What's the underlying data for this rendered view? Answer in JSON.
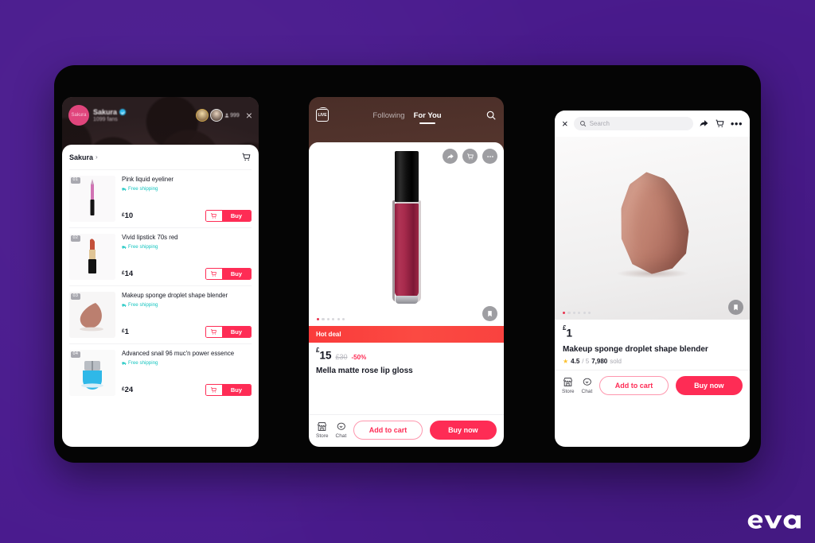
{
  "background": {
    "color": "#4a1b8e",
    "frame_color": "#050505"
  },
  "brand": {
    "logo_text": "eva"
  },
  "phone_left": {
    "name": "live-shopping-stream",
    "stream": {
      "streamer_name": "Sakura",
      "fans": "1099 fans",
      "avatar_label": "Sakura",
      "viewer_count": "999",
      "close_label": "×",
      "verified": true
    },
    "sheet": {
      "shop_name": "Sakura",
      "chevron": "›",
      "cart_icon": "cart-icon",
      "products": [
        {
          "rank": "01",
          "title": "Pink liquid eyeliner",
          "shipping": "Free shipping",
          "price_symbol": "£",
          "price": "10",
          "buy_label": "Buy"
        },
        {
          "rank": "02",
          "title": "Vivid lipstick 70s red",
          "shipping": "Free shipping",
          "price_symbol": "£",
          "price": "14",
          "buy_label": "Buy"
        },
        {
          "rank": "03",
          "title": "Makeup sponge droplet shape blender",
          "shipping": "Free shipping",
          "price_symbol": "£",
          "price": "1",
          "buy_label": "Buy"
        },
        {
          "rank": "04",
          "title": "Advanced snail 96 muc'n power essence",
          "shipping": "Free shipping",
          "price_symbol": "£",
          "price": "24",
          "buy_label": "Buy"
        }
      ]
    }
  },
  "phone_middle": {
    "name": "video-feed-product-card",
    "feed": {
      "live_label": "LIVE",
      "tab_following": "Following",
      "tab_foryou": "For You",
      "search_icon": "search-icon"
    },
    "card": {
      "share_icon": "share-icon",
      "cart_icon": "cart-icon",
      "more_icon": "more-icon",
      "bookmark_icon": "bookmark-icon",
      "carousel_dots": 6,
      "active_dot": 1,
      "banner": "Hot deal",
      "price_symbol": "£",
      "price": "15",
      "old_price": "£30",
      "discount": "-50%",
      "title": "Mella matte rose lip gloss",
      "store_label": "Store",
      "chat_label": "Chat",
      "add_to_cart": "Add to cart",
      "buy_now": "Buy now"
    }
  },
  "phone_right": {
    "name": "product-detail-page",
    "topbar": {
      "close_label": "×",
      "search_placeholder": "Search",
      "search_icon": "search-icon",
      "share_icon": "share-icon",
      "cart_icon": "cart-icon",
      "more_icon": "more-icon"
    },
    "gallery": {
      "carousel_dots": 6,
      "active_dot": 1,
      "bookmark_icon": "bookmark-icon"
    },
    "product": {
      "price_symbol": "£",
      "price": "1",
      "title": "Makeup sponge droplet shape blender",
      "star_icon": "star-icon",
      "rating": "4.5",
      "rating_max": "/ 5",
      "sold_count": "7,980",
      "sold_label": "sold"
    },
    "actions": {
      "store_label": "Store",
      "chat_label": "Chat",
      "add_to_cart": "Add to cart",
      "buy_now": "Buy now"
    }
  }
}
